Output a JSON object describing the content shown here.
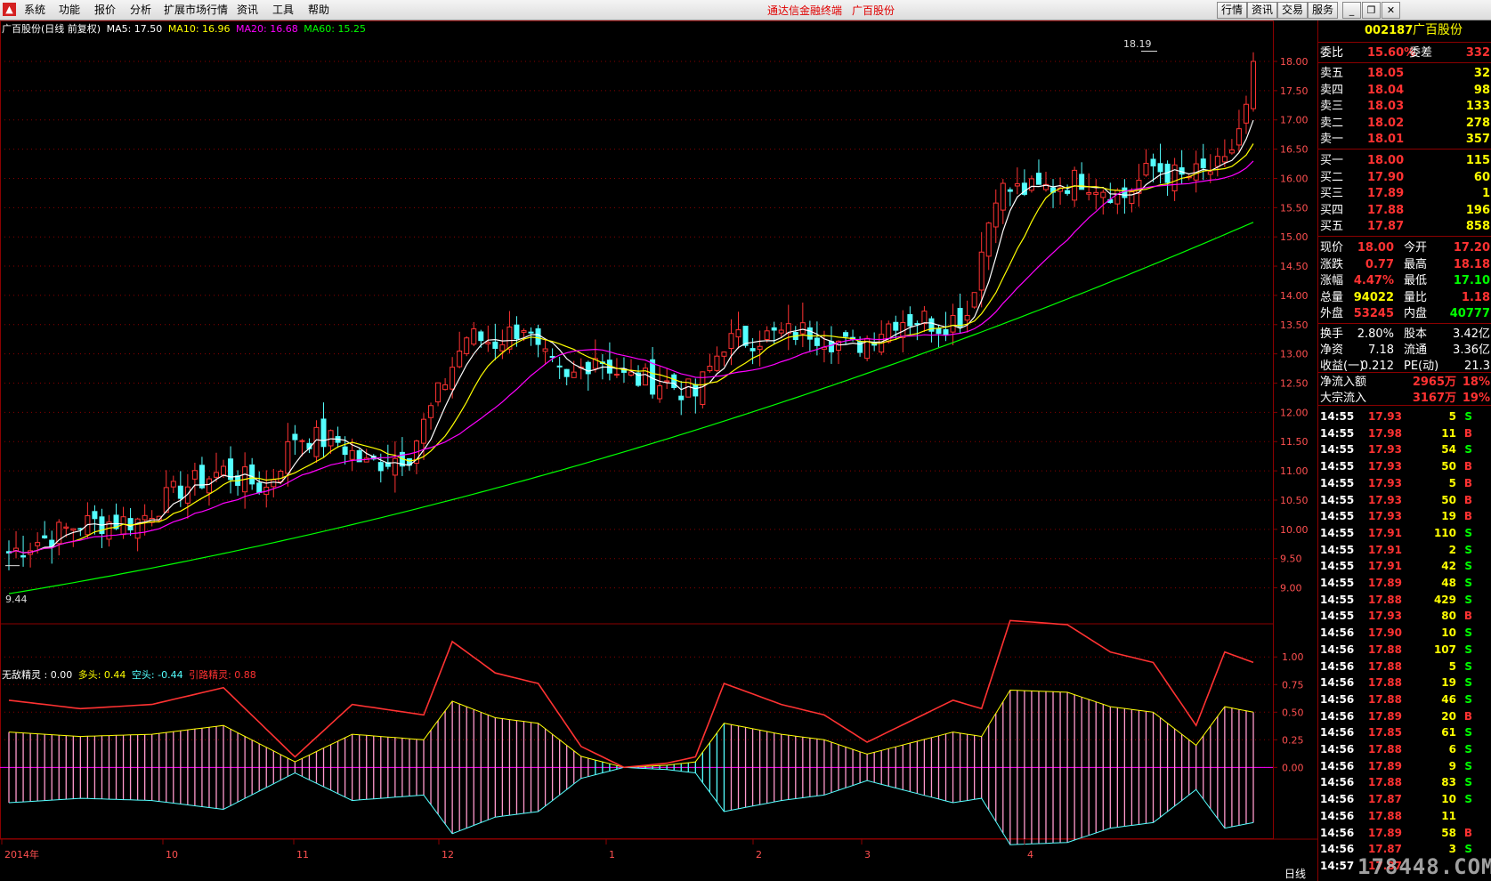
{
  "menu": {
    "items": [
      "系统",
      "功能",
      "报价",
      "分析",
      "扩展市场行情",
      "资讯",
      "工具",
      "帮助"
    ],
    "center_title": "通达信金融终端",
    "center_stock": "广百股份",
    "right_buttons": [
      "行情",
      "资讯",
      "交易",
      "服务"
    ]
  },
  "chart_header": {
    "title": "广百股份(日线 前复权)",
    "ma5": "MA5: 17.50",
    "ma10": "MA10: 16.96",
    "ma20": "MA20: 16.68",
    "ma60": "MA60: 15.25",
    "high_label": "18.19",
    "low_label": "9.44",
    "period_label": "日线"
  },
  "indicator_header": {
    "name": "无敌精灵 : 0.00",
    "long": "多头: 0.44",
    "short": "空头: -0.44",
    "lead": "引路精灵: 0.88"
  },
  "colors": {
    "up": "#ff3232",
    "down": "#54ffff",
    "ma5": "#ffffff",
    "ma10": "#ffff00",
    "ma20": "#ff00ff",
    "ma60": "#00ff00",
    "grid": "#8b0000",
    "axis_text": "#ff5050"
  },
  "chart_data": {
    "type": "candlestick",
    "title": "广百股份(日线 前复权)",
    "y_ticks": [
      18.0,
      17.5,
      17.0,
      16.5,
      16.0,
      15.5,
      15.0,
      14.5,
      14.0,
      13.5,
      13.0,
      12.5,
      12.0,
      11.5,
      11.0,
      10.5,
      10.0,
      9.5,
      9.0
    ],
    "ylim": [
      8.4,
      18.7
    ],
    "x_ticks": [
      "2014年",
      "10",
      "11",
      "12",
      "1",
      "2",
      "3",
      "4"
    ],
    "ma_values": {
      "MA5": 17.5,
      "MA10": 16.96,
      "MA20": 16.68,
      "MA60": 15.25
    },
    "high": 18.19,
    "low": 9.44,
    "indicator": {
      "name": "无敌精灵",
      "y_ticks": [
        1.0,
        0.75,
        0.5,
        0.25,
        0.0
      ],
      "ylim": [
        -0.65,
        1.3
      ],
      "values": {
        "无敌精灵": 0.0,
        "多头": 0.44,
        "空头": -0.44,
        "引路精灵": 0.88
      }
    }
  },
  "quote": {
    "code": "002187",
    "name": "广百股份",
    "weibi_label": "委比",
    "weibi": "15.60%",
    "weicha_label": "委差",
    "weicha": "332",
    "asks": [
      {
        "label": "卖五",
        "price": "18.05",
        "vol": "32"
      },
      {
        "label": "卖四",
        "price": "18.04",
        "vol": "98"
      },
      {
        "label": "卖三",
        "price": "18.03",
        "vol": "133"
      },
      {
        "label": "卖二",
        "price": "18.02",
        "vol": "278"
      },
      {
        "label": "卖一",
        "price": "18.01",
        "vol": "357"
      }
    ],
    "bids": [
      {
        "label": "买一",
        "price": "18.00",
        "vol": "115"
      },
      {
        "label": "买二",
        "price": "17.90",
        "vol": "60"
      },
      {
        "label": "买三",
        "price": "17.89",
        "vol": "1"
      },
      {
        "label": "买四",
        "price": "17.88",
        "vol": "196"
      },
      {
        "label": "买五",
        "price": "17.87",
        "vol": "858"
      }
    ],
    "stats": [
      {
        "l1": "现价",
        "v1": "18.00",
        "l2": "今开",
        "v2": "17.20"
      },
      {
        "l1": "涨跌",
        "v1": "0.77",
        "l2": "最高",
        "v2": "18.18"
      },
      {
        "l1": "涨幅",
        "v1": "4.47%",
        "l2": "最低",
        "v2": "17.10"
      },
      {
        "l1": "总量",
        "v1": "94022",
        "l2": "量比",
        "v2": "1.18"
      },
      {
        "l1": "外盘",
        "v1": "53245",
        "l2": "内盘",
        "v2": "40777"
      }
    ],
    "stats2": [
      {
        "l1": "换手",
        "v1": "2.80%",
        "l2": "股本",
        "v2": "3.42亿"
      },
      {
        "l1": "净资",
        "v1": "7.18",
        "l2": "流通",
        "v2": "3.36亿"
      },
      {
        "l1": "收益(一)",
        "v1": "0.212",
        "l2": "PE(动)",
        "v2": "21.3"
      }
    ],
    "flow": [
      {
        "label": "净流入额",
        "value": "2965万",
        "pct": "18%"
      },
      {
        "label": "大宗流入",
        "value": "3167万",
        "pct": "19%"
      }
    ],
    "ticks": [
      {
        "t": "14:55",
        "p": "17.93",
        "v": "5",
        "s": "S"
      },
      {
        "t": "14:55",
        "p": "17.98",
        "v": "11",
        "s": "B"
      },
      {
        "t": "14:55",
        "p": "17.93",
        "v": "54",
        "s": "S"
      },
      {
        "t": "14:55",
        "p": "17.93",
        "v": "50",
        "s": "B"
      },
      {
        "t": "14:55",
        "p": "17.93",
        "v": "5",
        "s": "B"
      },
      {
        "t": "14:55",
        "p": "17.93",
        "v": "50",
        "s": "B"
      },
      {
        "t": "14:55",
        "p": "17.93",
        "v": "19",
        "s": "B"
      },
      {
        "t": "14:55",
        "p": "17.91",
        "v": "110",
        "s": "S"
      },
      {
        "t": "14:55",
        "p": "17.91",
        "v": "2",
        "s": "S"
      },
      {
        "t": "14:55",
        "p": "17.91",
        "v": "42",
        "s": "S"
      },
      {
        "t": "14:55",
        "p": "17.89",
        "v": "48",
        "s": "S"
      },
      {
        "t": "14:55",
        "p": "17.88",
        "v": "429",
        "s": "S"
      },
      {
        "t": "14:55",
        "p": "17.93",
        "v": "80",
        "s": "B"
      },
      {
        "t": "14:56",
        "p": "17.90",
        "v": "10",
        "s": "S"
      },
      {
        "t": "14:56",
        "p": "17.88",
        "v": "107",
        "s": "S"
      },
      {
        "t": "14:56",
        "p": "17.88",
        "v": "5",
        "s": "S"
      },
      {
        "t": "14:56",
        "p": "17.88",
        "v": "19",
        "s": "S"
      },
      {
        "t": "14:56",
        "p": "17.88",
        "v": "46",
        "s": "S"
      },
      {
        "t": "14:56",
        "p": "17.89",
        "v": "20",
        "s": "B"
      },
      {
        "t": "14:56",
        "p": "17.85",
        "v": "61",
        "s": "S"
      },
      {
        "t": "14:56",
        "p": "17.88",
        "v": "6",
        "s": "S"
      },
      {
        "t": "14:56",
        "p": "17.89",
        "v": "9",
        "s": "S"
      },
      {
        "t": "14:56",
        "p": "17.88",
        "v": "83",
        "s": "S"
      },
      {
        "t": "14:56",
        "p": "17.87",
        "v": "10",
        "s": "S"
      },
      {
        "t": "14:56",
        "p": "17.88",
        "v": "11",
        "s": ""
      },
      {
        "t": "14:56",
        "p": "17.89",
        "v": "58",
        "s": "B"
      },
      {
        "t": "14:56",
        "p": "17.87",
        "v": "3",
        "s": "S"
      },
      {
        "t": "14:57",
        "p": "17.87",
        "v": "",
        "s": ""
      }
    ]
  },
  "watermark": "178448.COM"
}
